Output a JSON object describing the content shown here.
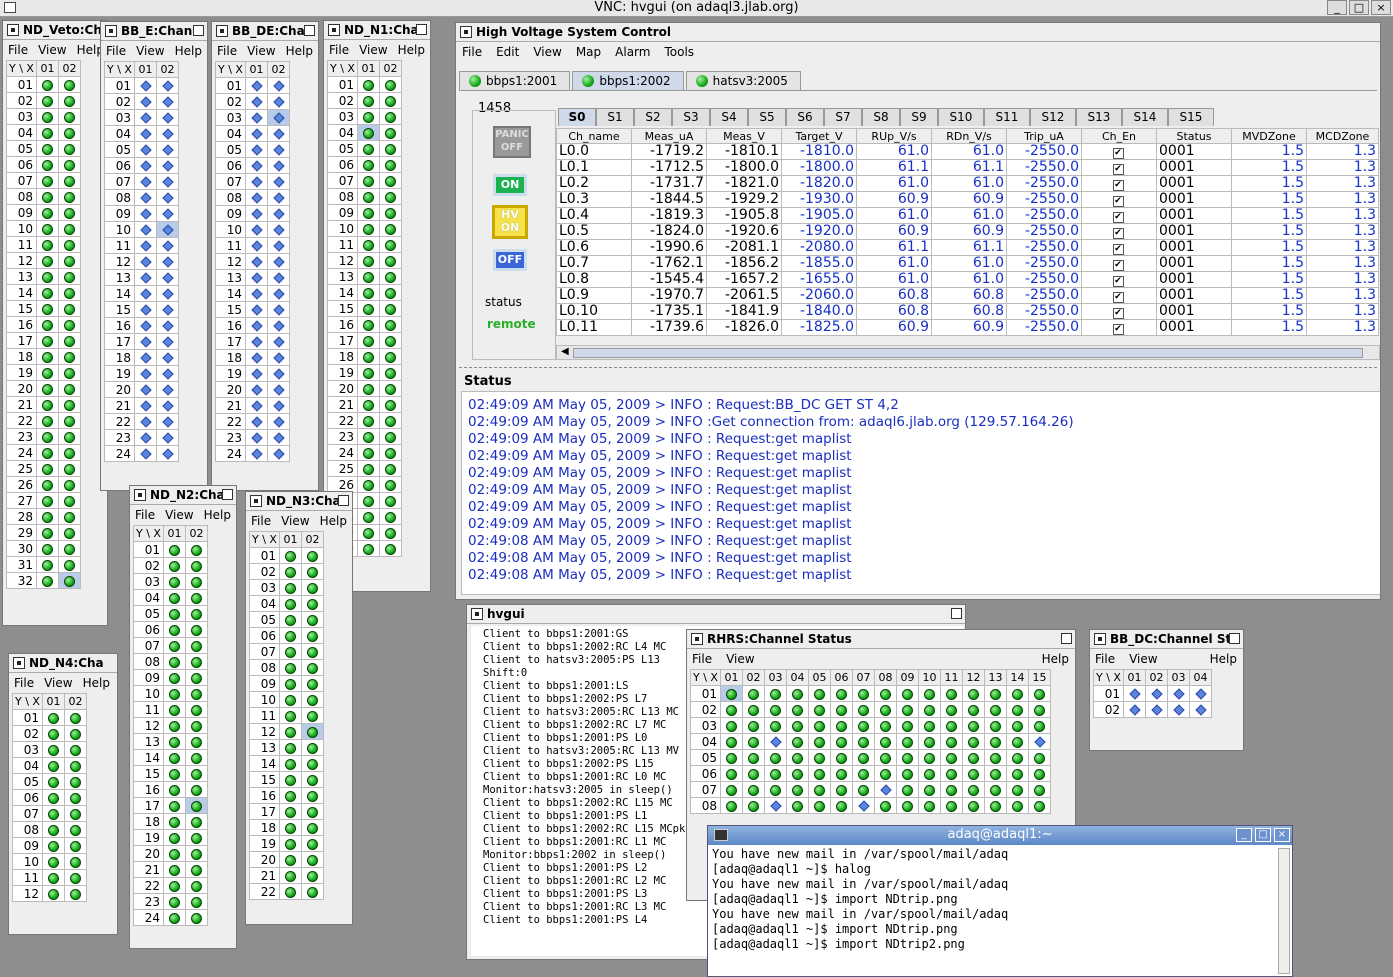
{
  "vnc": {
    "title": "VNC: hvgui (on adaql3.jlab.org)"
  },
  "menus": {
    "file": "File",
    "view": "View",
    "help": "Help",
    "edit": "Edit",
    "map": "Map",
    "alarm": "Alarm",
    "tools": "Tools"
  },
  "grid_header": {
    "yx": "Y \\ X",
    "c1": "01",
    "c2": "02",
    "c3": "03",
    "c4": "04"
  },
  "small_windows": [
    {
      "title": "ND_Veto:Ch"
    },
    {
      "title": "BB_E:Chan"
    },
    {
      "title": "BB_DE:Cha"
    },
    {
      "title": "ND_N1:Cha"
    },
    {
      "title": "ND_N2:Cha"
    },
    {
      "title": "ND_N3:Cha"
    },
    {
      "title": "ND_N4:Cha"
    }
  ],
  "hv_control": {
    "title": "High Voltage System Control",
    "tabs": [
      "bbps1:2001",
      "bbps1:2002",
      "hatsv3:2005"
    ],
    "active_tab": "bbps1:2002",
    "crate_id": "1458",
    "panic_label": "PANIC OFF",
    "on_label": "ON",
    "hv_on_label": "HV ON",
    "off_label": "OFF",
    "status_label": "status",
    "status_value": "remote",
    "slot_tabs": [
      "S0",
      "S1",
      "S2",
      "S3",
      "S4",
      "S5",
      "S6",
      "S7",
      "S8",
      "S9",
      "S10",
      "S11",
      "S12",
      "S13",
      "S14",
      "S15"
    ],
    "columns": [
      "Ch_name",
      "Meas_uA",
      "Meas_V",
      "Target_V",
      "RUp_V/s",
      "RDn_V/s",
      "Trip_uA",
      "Ch_En",
      "Status",
      "MVDZone",
      "MCDZone"
    ],
    "rows": [
      [
        "L0.0",
        "-1719.2",
        "-1810.1",
        "-1810.0",
        "61.0",
        "61.0",
        "-2550.0",
        "✔",
        "0001",
        "1.5",
        "1.3"
      ],
      [
        "L0.1",
        "-1712.5",
        "-1800.0",
        "-1800.0",
        "61.1",
        "61.1",
        "-2550.0",
        "✔",
        "0001",
        "1.5",
        "1.3"
      ],
      [
        "L0.2",
        "-1731.7",
        "-1821.0",
        "-1820.0",
        "61.0",
        "61.0",
        "-2550.0",
        "✔",
        "0001",
        "1.5",
        "1.3"
      ],
      [
        "L0.3",
        "-1844.5",
        "-1929.2",
        "-1930.0",
        "60.9",
        "60.9",
        "-2550.0",
        "✔",
        "0001",
        "1.5",
        "1.3"
      ],
      [
        "L0.4",
        "-1819.3",
        "-1905.8",
        "-1905.0",
        "61.0",
        "61.0",
        "-2550.0",
        "✔",
        "0001",
        "1.5",
        "1.3"
      ],
      [
        "L0.5",
        "-1824.0",
        "-1920.6",
        "-1920.0",
        "60.9",
        "60.9",
        "-2550.0",
        "✔",
        "0001",
        "1.5",
        "1.3"
      ],
      [
        "L0.6",
        "-1990.6",
        "-2081.1",
        "-2080.0",
        "61.1",
        "61.1",
        "-2550.0",
        "✔",
        "0001",
        "1.5",
        "1.3"
      ],
      [
        "L0.7",
        "-1762.1",
        "-1856.2",
        "-1855.0",
        "61.0",
        "61.0",
        "-2550.0",
        "✔",
        "0001",
        "1.5",
        "1.3"
      ],
      [
        "L0.8",
        "-1545.4",
        "-1657.2",
        "-1655.0",
        "61.0",
        "61.0",
        "-2550.0",
        "✔",
        "0001",
        "1.5",
        "1.3"
      ],
      [
        "L0.9",
        "-1970.7",
        "-2061.5",
        "-2060.0",
        "60.8",
        "60.8",
        "-2550.0",
        "✔",
        "0001",
        "1.5",
        "1.3"
      ],
      [
        "L0.10",
        "-1735.1",
        "-1841.9",
        "-1840.0",
        "60.8",
        "60.8",
        "-2550.0",
        "✔",
        "0001",
        "1.5",
        "1.3"
      ],
      [
        "L0.11",
        "-1739.6",
        "-1826.0",
        "-1825.0",
        "60.9",
        "60.9",
        "-2550.0",
        "✔",
        "0001",
        "1.5",
        "1.3"
      ]
    ],
    "status_title": "Status",
    "log": [
      "02:49:09 AM May 05, 2009 > INFO : Request:BB_DC GET ST 4,2",
      "02:49:09 AM May 05, 2009 > INFO :Get connection from: adaql6.jlab.org (129.57.164.26)",
      "02:49:09 AM May 05, 2009 > INFO : Request:get maplist",
      "02:49:09 AM May 05, 2009 > INFO : Request:get maplist",
      "02:49:09 AM May 05, 2009 > INFO : Request:get maplist",
      "02:49:09 AM May 05, 2009 > INFO : Request:get maplist",
      "02:49:09 AM May 05, 2009 > INFO : Request:get maplist",
      "02:49:09 AM May 05, 2009 > INFO : Request:get maplist",
      "02:49:08 AM May 05, 2009 > INFO : Request:get maplist",
      "02:49:08 AM May 05, 2009 > INFO : Request:get maplist",
      "02:49:08 AM May 05, 2009 > INFO : Request:get maplist"
    ]
  },
  "hvgui": {
    "title": "hvgui",
    "lines": [
      "Client to bbps1:2001:GS",
      "Client to bbps1:2002:RC L4 MC",
      "Client to hatsv3:2005:PS L13",
      "Shift:0",
      "Client to bbps1:2001:LS",
      "Client to bbps1:2002:PS L7",
      "Client to hatsv3:2005:RC L13 MC",
      "Client to bbps1:2002:RC L7 MC",
      "Client to bbps1:2001:PS L0",
      "Client to hatsv3:2005:RC L13 MV",
      "Client to bbps1:2002:PS L15",
      "Client to bbps1:2001:RC L0 MC",
      "Monitor:hatsv3:2005 in sleep()",
      "Client to bbps1:2002:RC L15 MC",
      "Client to bbps1:2001:PS L1",
      "Client to bbps1:2002:RC L15 MCpk",
      "Client to bbps1:2001:RC L1 MC",
      "Monitor:bbps1:2002 in sleep()",
      "Client to bbps1:2001:PS L2",
      "Client to bbps1:2001:RC L2 MC",
      "Client to bbps1:2001:PS L3",
      "Client to bbps1:2001:RC L3 MC",
      "Client to bbps1:2001:PS L4"
    ]
  },
  "rhrs": {
    "title": "RHRS:Channel Status",
    "cols": [
      "01",
      "02",
      "03",
      "04",
      "05",
      "06",
      "07",
      "08",
      "09",
      "10",
      "11",
      "12",
      "13",
      "14",
      "15"
    ]
  },
  "bbdc": {
    "title": "BB_DC:Channel Sta"
  },
  "terminal": {
    "title": "adaq@adaql1:~",
    "text": "You have new mail in /var/spool/mail/adaq\n[adaq@adaql1 ~]$ halog\nYou have new mail in /var/spool/mail/adaq\n[adaq@adaql1 ~]$ import NDtrip.png\nYou have new mail in /var/spool/mail/adaq\n[adaq@adaql1 ~]$ import NDtrip.png\n[adaq@adaql1 ~]$ import NDtrip2.png"
  }
}
